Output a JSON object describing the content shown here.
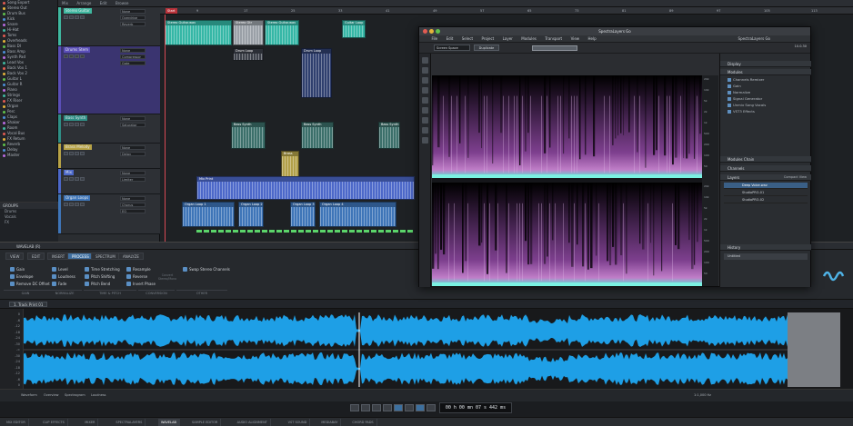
{
  "browser": {
    "items": [
      "Song Export",
      "Stereo Out",
      "Drum Bus",
      "Kick",
      "Snare",
      "Hi-Hat",
      "Toms",
      "Overheads",
      "Bass DI",
      "Bass Amp",
      "Synth Pad",
      "Lead Vox",
      "Back Vox 1",
      "Back Vox 2",
      "Guitar L",
      "Guitar R",
      "Piano",
      "Strings",
      "FX Riser",
      "Organ",
      "Perc",
      "Claps",
      "Shaker",
      "Room",
      "Vocal Bus",
      "FX Return",
      "Reverb",
      "Delay",
      "Master"
    ],
    "groups_title": "GROUPS",
    "groups": [
      "Drums",
      "Vocals",
      "FX"
    ]
  },
  "topbar": {
    "tabs": [
      "Mix",
      "Arrange",
      "Edit",
      "Browse"
    ]
  },
  "tracks": [
    {
      "name": "Stereo Guitar",
      "color": "#3fb8a0",
      "slots": [
        "None",
        "Overdrive",
        "Reverb"
      ]
    },
    {
      "name": "Drums Stem",
      "color": "#5b4fb8",
      "slots": [
        "None",
        "Compressor",
        "Gate"
      ]
    },
    {
      "name": "Bass Synth",
      "color": "#2f8f86",
      "slots": [
        "None",
        "Saturator"
      ]
    },
    {
      "name": "Brass Melody",
      "color": "#b8a346",
      "slots": [
        "None",
        "Delay"
      ]
    },
    {
      "name": "Mix",
      "color": "#4c68c9",
      "slots": [
        "None",
        "Limiter"
      ]
    },
    {
      "name": "Organ Loops",
      "color": "#3e75b8",
      "slots": [
        "None",
        "Chorus",
        "EQ"
      ]
    }
  ],
  "ruler": {
    "marker": "Start",
    "ticks": [
      "9",
      "17",
      "25",
      "33",
      "41",
      "49",
      "57",
      "65",
      "73",
      "81",
      "89",
      "97",
      "105",
      "113"
    ]
  },
  "clips": {
    "guitar": [
      "Stereo Guitar.wav",
      "Stereo Gtr",
      "Guitar Loop"
    ],
    "drums": [
      "Drum Loop",
      "Drum Loop",
      "Drum Loop",
      "Drum Loop"
    ],
    "bass": [
      "Bass Synth",
      "Bass Synth",
      "Bass Synth",
      "Bass Synth"
    ],
    "brass": [
      "Brass"
    ],
    "mix": [
      "Mix Print"
    ],
    "organ": [
      "Organ Loop 1",
      "Organ Loop 2",
      "Organ Loop 3",
      "Organ Loop 4"
    ]
  },
  "editor": {
    "title": "WAVELAB (R)",
    "tabs": [
      "VIEW",
      "EDIT",
      "INSERT",
      "PROCESS",
      "SPECTRUM",
      "ANALYZE"
    ],
    "active_tab": "PROCESS",
    "buttons": [
      [
        "Gain",
        "Envelope",
        "Remove DC Offset"
      ],
      [
        "Level",
        "Loudness",
        "Fade"
      ],
      [
        "Time Stretching",
        "Pitch Shifting",
        "Pitch Bend"
      ],
      [
        "Resample",
        "Reverse",
        "Invert Phase"
      ],
      [
        "Swap Stereo Channels"
      ]
    ],
    "disabled_button": "Convert Stereo/Mono",
    "groups": [
      "GAIN",
      "NORMALIZE",
      "TIME & PITCH",
      "CONVERSION",
      "OTHER"
    ],
    "file_tab": "1. Track Print 01",
    "db_scale": [
      "0",
      "-6",
      "-12",
      "-18",
      "-24",
      "-30",
      "-∞",
      "-30",
      "-24",
      "-18",
      "-12",
      "-6",
      "0"
    ],
    "view_tabs": [
      "Waveform",
      "Overview",
      "Spectrogram",
      "Loudness"
    ],
    "zoom": "1:1,000 Hz",
    "time_display": "00 h 00 mn 07 s 442 ms"
  },
  "status_tabs": [
    "MIX EDITOR",
    "CLIP EFFECTS",
    "MIXER",
    "SPECTRALAYERS",
    "WAVELAB",
    "SAMPLE EDITOR",
    "AUDIO ALIGNMENT",
    "VST SOUND",
    "MEDIABAY",
    "CHORD PADS"
  ],
  "status_active": "WAVELAB",
  "spectral": {
    "title": "SpectraLayers Go",
    "menu": [
      "File",
      "Edit",
      "Select",
      "Project",
      "Layer",
      "Modules",
      "Transport",
      "View",
      "Help"
    ],
    "menu_right": "SpectraLayers Go",
    "view_mode": "Screen Space",
    "duplicate": "Duplicate",
    "version": "10.0.30",
    "freq_labels": [
      "20k",
      "10k",
      "5k",
      "2k",
      "1k",
      "500",
      "200",
      "100",
      "50"
    ],
    "panel": {
      "display": "Display",
      "modules": "Modules",
      "module_items": [
        "Channels Remixer",
        "Gain",
        "Normalize",
        "Signal Generator",
        "Unmix Song Vocals",
        "VST3 Effects"
      ],
      "modules_chain": "Modules Chain",
      "channels": "Channels",
      "compact_view": "Compact View",
      "layers": "Layers",
      "layer_items": [
        "Deep Voice.wav",
        "StudioPRO-01",
        "StudioPRO-02"
      ],
      "history": "History",
      "history_item": "Untitled"
    }
  }
}
